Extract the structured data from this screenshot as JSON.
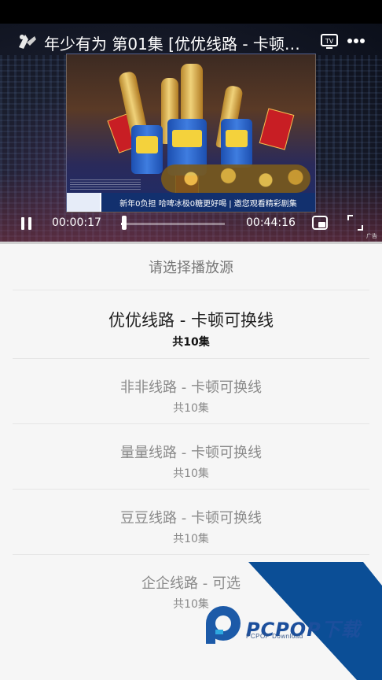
{
  "player": {
    "title": "年少有为 第01集 [优优线路 - 卡顿…",
    "time_current": "00:00:17",
    "time_total": "00:44:16",
    "progress": 0.0064,
    "ad_caption": "新年0负担 哈啤冰极0糖更好喝   |   邀您观看精彩剧集",
    "ad_tag": "广告",
    "icons": {
      "back": "back-logo-icon",
      "tv": "tv-cast-icon",
      "more": "more-dots-icon",
      "pause": "pause-icon",
      "pip": "pip-icon",
      "fullscreen": "fullscreen-icon"
    }
  },
  "sheet": {
    "title": "请选择播放源",
    "sources": [
      {
        "name": "优优线路 - 卡顿可换线",
        "count": "共10集",
        "selected": true
      },
      {
        "name": "非非线路 - 卡顿可换线",
        "count": "共10集",
        "selected": false
      },
      {
        "name": "量量线路 - 卡顿可换线",
        "count": "共10集",
        "selected": false
      },
      {
        "name": "豆豆线路 - 卡顿可换线",
        "count": "共10集",
        "selected": false
      },
      {
        "name": "企企线路 - 可选",
        "count": "共10集",
        "selected": false
      }
    ]
  },
  "watermark": {
    "brand": "PCPOP下载",
    "subtitle": "PCPOP Download"
  },
  "colors": {
    "accent_blue": "#1c4f9c",
    "sheet_bg": "#f6f6f6",
    "selected_text": "#222222",
    "inactive_text": "#8a8a8a"
  }
}
